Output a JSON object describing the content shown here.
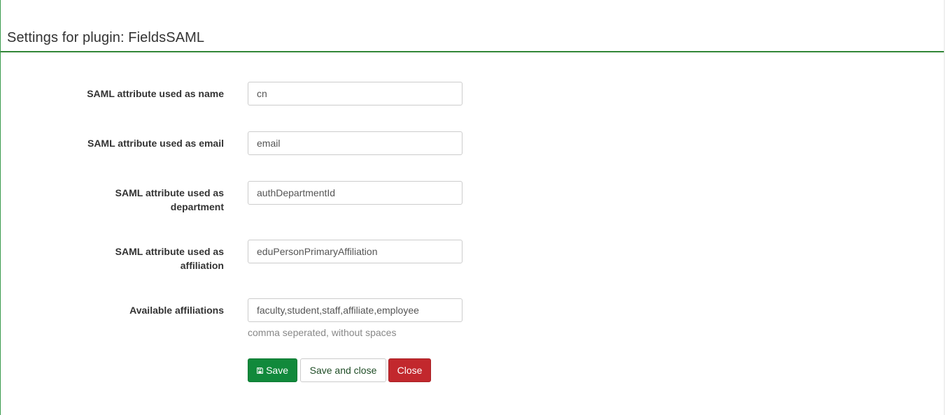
{
  "header": {
    "title": "Settings for plugin: FieldsSAML"
  },
  "fields": [
    {
      "label": "SAML attribute used as name",
      "value": "cn"
    },
    {
      "label": "SAML attribute used as email",
      "value": "email"
    },
    {
      "label_line1": "SAML attribute used as",
      "label_line2": "department",
      "value": "authDepartmentId"
    },
    {
      "label_line1": "SAML attribute used as",
      "label_line2": "affiliation",
      "value": "eduPersonPrimaryAffiliation"
    },
    {
      "label": "Available affiliations",
      "value": "faculty,student,staff,affiliate,employee",
      "help": "comma seperated, without spaces"
    }
  ],
  "buttons": {
    "save": "Save",
    "save_and_close": "Save and close",
    "close": "Close"
  },
  "icons": {
    "save": "floppy-disk-icon"
  },
  "colors": {
    "accent_green": "#11893b",
    "header_border": "#328637",
    "close_red": "#c2282d"
  }
}
